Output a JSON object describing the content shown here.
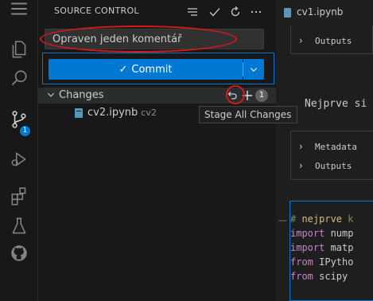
{
  "activity_bar": {
    "items": [
      {
        "icon": "menu-icon"
      },
      {
        "icon": "explorer-icon"
      },
      {
        "icon": "search-icon"
      },
      {
        "icon": "source-control-icon",
        "badge": "1"
      },
      {
        "icon": "run-debug-icon"
      },
      {
        "icon": "extensions-icon"
      },
      {
        "icon": "testing-icon"
      },
      {
        "icon": "github-icon"
      }
    ]
  },
  "scm": {
    "title": "SOURCE CONTROL",
    "header_icons": [
      "view-as-tree-icon",
      "check-icon",
      "refresh-icon",
      "more-icon"
    ],
    "message_value": "Opraven jeden komentář",
    "commit_label": "Commit",
    "changes": {
      "label": "Changes",
      "count": "1",
      "files": [
        {
          "name": "cv2.ipynb",
          "dir": "cv2"
        }
      ]
    },
    "tooltip": "Stage All Changes"
  },
  "editor": {
    "tab_label": "cv1.ipynb",
    "outputs_label_1": "Outputs",
    "markdown_text": "Nejprve si",
    "metadata_label": "Metadata",
    "outputs_label_2": "Outputs",
    "code": {
      "comment_prefix": "# ",
      "comment_word": "nejprve",
      "comment_rest": " k",
      "line2_kw": "import",
      "line2_id": " nump",
      "line3_kw": "import",
      "line3_id": " matp",
      "line4_kw": "from",
      "line4_id": " IPytho",
      "line5_kw": "from",
      "line5_id": " scipy"
    }
  },
  "colors": {
    "accent": "#0078d4",
    "annotation_red": "#d51a1a"
  }
}
